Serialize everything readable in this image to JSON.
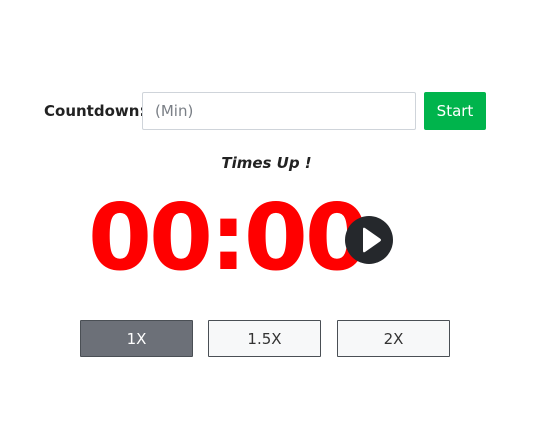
{
  "countdown": {
    "label": "Countdown:",
    "input_placeholder": "(Min)",
    "input_value": "",
    "start_label": "Start"
  },
  "status": {
    "message": "Times Up !"
  },
  "timer": {
    "display": "00:00",
    "color": "#ff0000",
    "control_icon": "play-icon"
  },
  "speed": {
    "options": [
      {
        "label": "1X",
        "selected": true
      },
      {
        "label": "1.5X",
        "selected": false
      },
      {
        "label": "2X",
        "selected": false
      }
    ]
  },
  "colors": {
    "start_button": "#00b44c",
    "selected_speed": "#6c7078",
    "play_button": "#25282c"
  }
}
